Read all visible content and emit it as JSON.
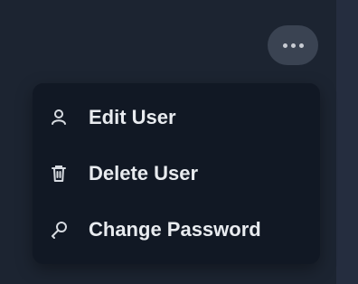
{
  "menu": {
    "items": [
      {
        "label": "Edit User",
        "icon": "user-icon"
      },
      {
        "label": "Delete User",
        "icon": "trash-icon"
      },
      {
        "label": "Change Password",
        "icon": "key-icon"
      }
    ]
  },
  "colors": {
    "background": "#1c2431",
    "menu_bg": "#111824",
    "button_bg": "#3a4352",
    "text": "#e8ebef"
  }
}
